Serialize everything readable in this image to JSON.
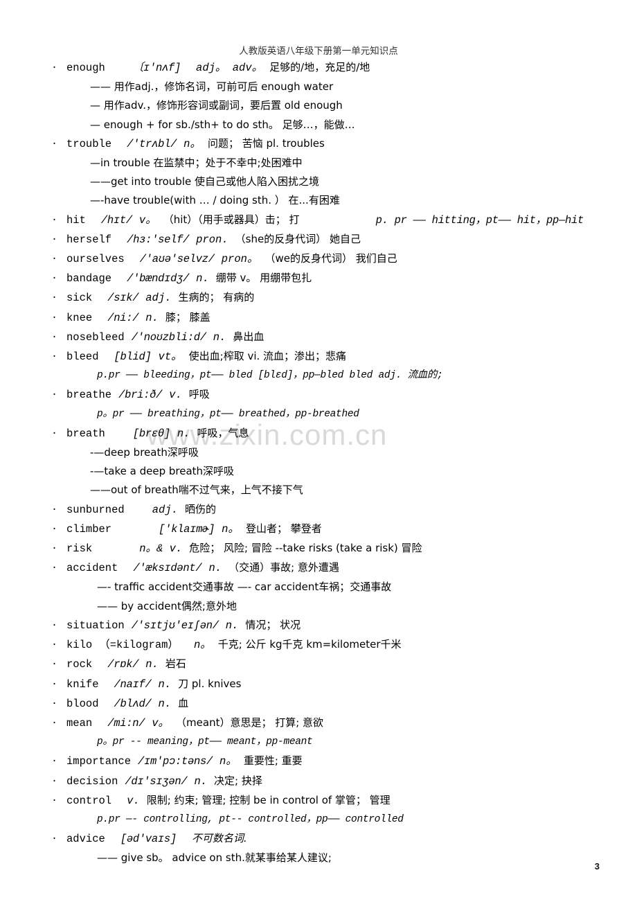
{
  "document": {
    "title": "人教版英语八年级下册第一单元知识点",
    "page_number": "3",
    "watermark": "www.zixin.com.cn"
  },
  "entries": [
    {
      "word": "enough",
      "phonetic": "〔ɪ'nʌf]",
      "pos": "adj。 adv。",
      "meaning": "足够的/地，充足的/地",
      "lines": [
        "—— 用作adj.，修饰名词，可前可后            enough water",
        "— 用作adv.，修饰形容词或副词，要后置    old enough",
        "— enough + for sb./sth+ to do sth。  足够…，能做…"
      ]
    },
    {
      "word": "trouble",
      "phonetic": "/'trʌbl/",
      "pos": "n。",
      "meaning": "问题； 苦恼  pl. troubles",
      "lines": [
        "—in trouble 在监禁中；处于不幸中;处困难中",
        "——get into trouble 使自己或他人陷入困扰之境",
        "—-have trouble(with … / doing sth. ） 在...有困难"
      ]
    },
    {
      "word": "hit",
      "phonetic": "/hɪt/",
      "pos": "v。",
      "meaning": "（hit）（用手或器具）击； 打",
      "forms_right": "p. pr  ——  hitting，pt—— hit，pp—hit",
      "lines": []
    },
    {
      "word": "herself",
      "phonetic": "/hɜ:'self/",
      "pos": "pron.",
      "meaning": "（she的反身代词） 她自己",
      "lines": []
    },
    {
      "word": "ourselves",
      "phonetic": "/'aʊə'selvz/",
      "pos": "pron。",
      "meaning": "（we的反身代词） 我们自己",
      "lines": []
    },
    {
      "word": "bandage",
      "phonetic": "/'bændɪdʒ/",
      "pos": "n.",
      "meaning": "绷带 v。 用绷带包扎",
      "lines": []
    },
    {
      "word": "sick",
      "phonetic": "/sɪk/",
      "pos": "adj.",
      "meaning": "生病的； 有病的",
      "lines": []
    },
    {
      "word": "knee",
      "phonetic": "/ni:/",
      "pos": "n.",
      "meaning": "膝； 膝盖",
      "lines": []
    },
    {
      "word": "nosebleed",
      "phonetic": "/'noʊzbli:d/",
      "pos": "n.",
      "meaning": "鼻出血",
      "lines": []
    },
    {
      "word": "bleed",
      "phonetic": "[blid]",
      "pos": "vt。",
      "meaning": "使出血;榨取   vi. 流血；渗出；悲痛",
      "forms": "p.pr —— bleeding，pt—— bled [blɛd]，pp—bled    bled  adj. 流血的;",
      "lines": []
    },
    {
      "word": "breathe",
      "phonetic": "/bri:ð/",
      "pos": "v.",
      "meaning": "呼吸",
      "forms": "p。pr —— breathing，pt—— breathed，pp-breathed",
      "lines": []
    },
    {
      "word": "breath",
      "phonetic": "[brɛθ]",
      "pos": "n.",
      "meaning": "呼吸，气息",
      "lines": [
        "-—deep breath深呼吸",
        "-—take a deep breath深呼吸",
        "——out of breath喘不过气来，上气不接下气"
      ]
    },
    {
      "word": "sunburned",
      "phonetic": "",
      "pos": "adj.",
      "meaning": "晒伤的",
      "lines": []
    },
    {
      "word": "climber",
      "phonetic": "['klaɪmɚ]",
      "pos": "n。",
      "meaning": "登山者； 攀登者",
      "lines": []
    },
    {
      "word": "risk",
      "phonetic": "",
      "pos": "n。& v.",
      "meaning": "危险； 风险; 冒险   --take risks (take a risk)    冒险",
      "lines": []
    },
    {
      "word": "accident",
      "phonetic": "/'æksɪdənt/",
      "pos": "n.",
      "meaning": "（交通）事故; 意外遭遇",
      "lines": [
        "—- traffic accident交通事故  —- car accident车祸；交通事故",
        "—— by accident偶然;意外地"
      ]
    },
    {
      "word": "situation",
      "phonetic": "/'sɪtjʊ'eɪʃən/",
      "pos": "n.",
      "meaning": "情况； 状况",
      "lines": []
    },
    {
      "word": "kilo",
      "phonetic": "（=kilogram）",
      "pos": "n。",
      "meaning": "千克; 公斤  kg千克  km=kilometer千米",
      "lines": []
    },
    {
      "word": "rock",
      "phonetic": "/rɒk/",
      "pos": "n.",
      "meaning": "岩石",
      "lines": []
    },
    {
      "word": "knife",
      "phonetic": "/naɪf/",
      "pos": "n.",
      "meaning": "刀  pl.  knives",
      "lines": []
    },
    {
      "word": "blood",
      "phonetic": "/blʌd/",
      "pos": "n.",
      "meaning": "血",
      "lines": []
    },
    {
      "word": "mean",
      "phonetic": "/mi:n/",
      "pos": "v。",
      "meaning": "（meant）意思是； 打算; 意欲",
      "forms": "p。pr -- meaning，pt—— meant，pp-meant",
      "lines": []
    },
    {
      "word": "importance",
      "phonetic": "/ɪm'pɔ:təns/",
      "pos": "n。",
      "meaning": "重要性; 重要",
      "lines": []
    },
    {
      "word": "decision",
      "phonetic": "/dɪ'sɪʒən/",
      "pos": "n.",
      "meaning": "决定; 抉择",
      "lines": []
    },
    {
      "word": "control",
      "phonetic": "",
      "pos": "v.",
      "meaning": "限制; 约束; 管理; 控制   be in control of   掌管； 管理",
      "forms": "p.pr —- controlling, pt-- controlled，pp—— controlled",
      "lines": []
    },
    {
      "word": "advice",
      "phonetic": "[əd'vaɪs]",
      "pos": "",
      "meaning": "不可数名词.",
      "lines": [
        "—— give sb。 advice on sth.就某事给某人建议;"
      ]
    }
  ]
}
